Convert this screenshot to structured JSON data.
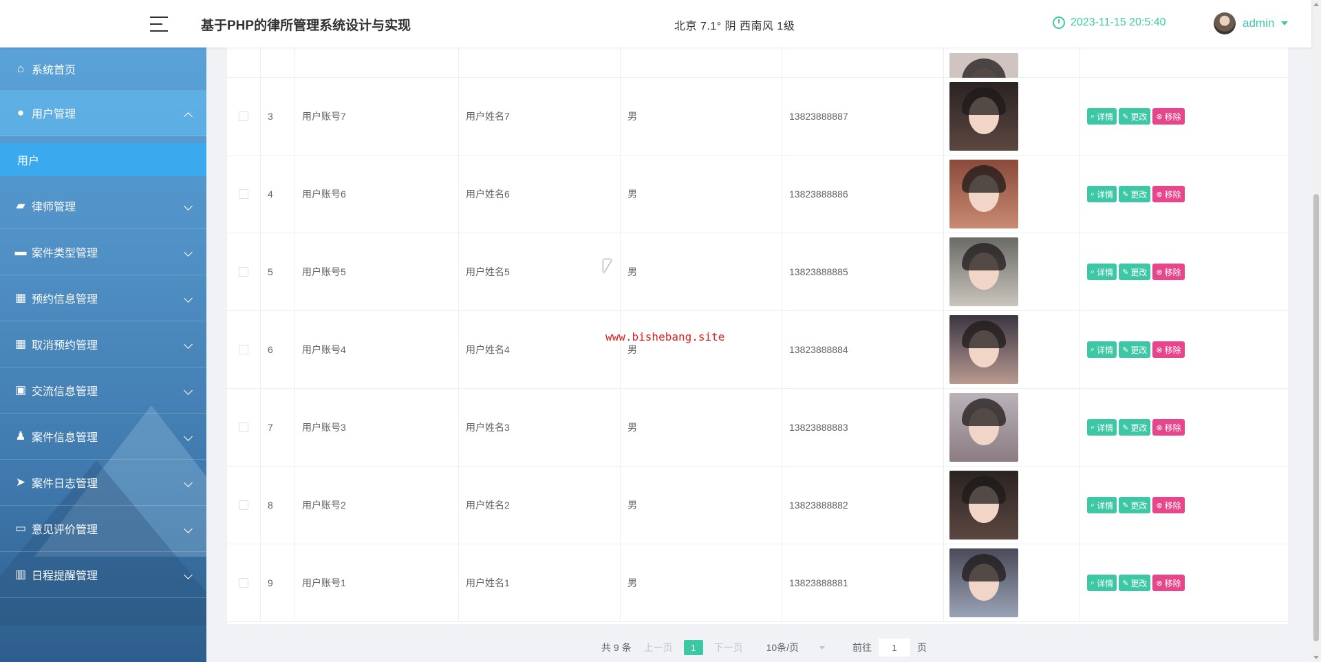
{
  "header": {
    "title": "基于PHP的律所管理系统设计与实现",
    "weather": "北京  7.1°  阴  西南风  1级",
    "datetime": "2023-11-15 20:5:40",
    "user": "admin"
  },
  "sidebar": {
    "items": [
      {
        "label": "系统首页",
        "icon": "home-icon"
      },
      {
        "label": "用户管理",
        "icon": "user-manage-icon",
        "active": true,
        "sub": [
          {
            "label": "用户"
          }
        ]
      },
      {
        "label": "律师管理",
        "icon": "briefcase-icon"
      },
      {
        "label": "案件类型管理",
        "icon": "ticket-icon"
      },
      {
        "label": "预约信息管理",
        "icon": "grid-icon"
      },
      {
        "label": "取消预约管理",
        "icon": "grid-icon"
      },
      {
        "label": "交流信息管理",
        "icon": "case-icon"
      },
      {
        "label": "案件信息管理",
        "icon": "person-icon"
      },
      {
        "label": "案件日志管理",
        "icon": "send-icon"
      },
      {
        "label": "意见评价管理",
        "icon": "monitor-icon"
      },
      {
        "label": "日程提醒管理",
        "icon": "book-icon"
      }
    ]
  },
  "table": {
    "rows": [
      {
        "index": "3",
        "account": "用户账号7",
        "name": "用户姓名7",
        "sex": "男",
        "phone": "13823888887"
      },
      {
        "index": "4",
        "account": "用户账号6",
        "name": "用户姓名6",
        "sex": "男",
        "phone": "13823888886"
      },
      {
        "index": "5",
        "account": "用户账号5",
        "name": "用户姓名5",
        "sex": "男",
        "phone": "13823888885"
      },
      {
        "index": "6",
        "account": "用户账号4",
        "name": "用户姓名4",
        "sex": "男",
        "phone": "13823888884"
      },
      {
        "index": "7",
        "account": "用户账号3",
        "name": "用户姓名3",
        "sex": "男",
        "phone": "13823888883"
      },
      {
        "index": "8",
        "account": "用户账号2",
        "name": "用户姓名2",
        "sex": "男",
        "phone": "13823888882"
      },
      {
        "index": "9",
        "account": "用户账号1",
        "name": "用户姓名1",
        "sex": "男",
        "phone": "13823888881"
      }
    ],
    "actions": {
      "detail": "详情",
      "edit": "更改",
      "delete": "移除"
    }
  },
  "watermark": "www.bishebang.site",
  "pagination": {
    "total": "共 9 条",
    "prev": "上一页",
    "current": "1",
    "next": "下一页",
    "page_size": "10条/页",
    "goto_prefix": "前往",
    "goto_value": "1",
    "goto_suffix": "页"
  },
  "colors": {
    "accent": "#3ec7a5",
    "danger": "#e8468b",
    "sidebar": "#4f8fc4"
  }
}
